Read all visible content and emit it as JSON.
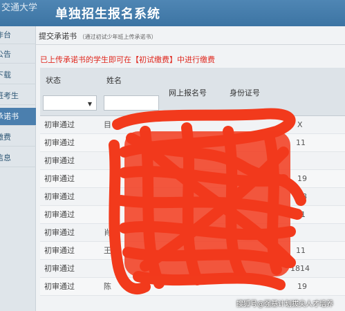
{
  "header": {
    "logo_text": "交通大学",
    "title": "单独招生报名系统"
  },
  "sidebar": {
    "items": [
      {
        "label": "作台",
        "active": false
      },
      {
        "label": "公告",
        "active": false
      },
      {
        "label": "下载",
        "active": false
      },
      {
        "label": "班考生",
        "active": false
      },
      {
        "label": "承诺书",
        "active": true
      },
      {
        "label": "缴费",
        "active": false
      },
      {
        "label": "信息",
        "active": false
      }
    ]
  },
  "panel": {
    "title": "提交承诺书",
    "hint": "（通过初试少年班上传承诺书）",
    "notice": "已上传承诺书的学生即可在【初试缴费】中进行缴费"
  },
  "table": {
    "headers": {
      "status": "状态",
      "name": "姓名",
      "reg_no": "网上报名号",
      "id_no": "身份证号"
    },
    "filter_select_caret": "▼",
    "rows": [
      {
        "status": "初审通过",
        "name": "目",
        "tail": "X"
      },
      {
        "status": "初审通过",
        "name": "",
        "tail": "11"
      },
      {
        "status": "初审通过",
        "name": "",
        "tail": ""
      },
      {
        "status": "初审通过",
        "name": "",
        "tail": "19"
      },
      {
        "status": "初审通过",
        "name": "",
        "tail": "28"
      },
      {
        "status": "初审通过",
        "name": "",
        "tail": "11"
      },
      {
        "status": "初审通过",
        "name": "肖",
        "tail": ""
      },
      {
        "status": "初审通过",
        "name": "王",
        "tail": "11"
      },
      {
        "status": "初审通过",
        "name": "",
        "tail": "1814"
      },
      {
        "status": "初审通过",
        "name": "陈",
        "tail": "19"
      }
    ]
  },
  "watermark": "搜狐号@强基计划拔尖人才培养",
  "colors": {
    "header": "#3c74a3",
    "active_item": "#4b7fae",
    "notice": "#e0281e",
    "scribble": "#f23a1c"
  }
}
